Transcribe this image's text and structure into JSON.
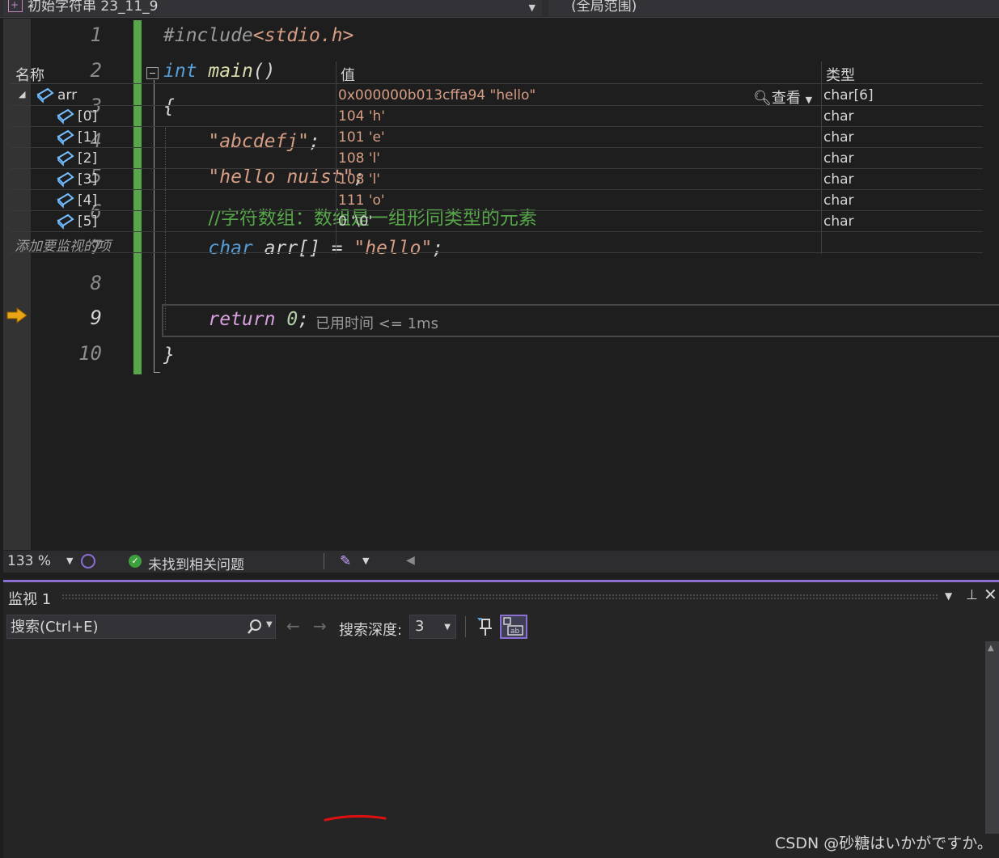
{
  "navbar": {
    "file_scope": "初始字符串 23_11_9",
    "member_scope": "(全局范围)"
  },
  "editor": {
    "line_numbers": [
      "1",
      "2",
      "3",
      "4",
      "5",
      "6",
      "7",
      "8",
      "9",
      "10"
    ],
    "current_line": "9",
    "lines": {
      "l1_directive": "#include",
      "l1_header": "<stdio.h>",
      "l2_type": "int",
      "l2_name": "main",
      "l2_parens": "()",
      "l3_brace": "{",
      "l4_string": "\"abcdefj\"",
      "l4_semi": ";",
      "l5_string": "\"hello nuist\"",
      "l5_semi": ";",
      "l6_comment": "//字符数组：数组是一组形同类型的元素",
      "l7_type": "char",
      "l7_decl": " arr[] = ",
      "l7_string": "\"hello\"",
      "l7_semi": ";",
      "l9_keyword": "return",
      "l9_number": " 0",
      "l9_semi": ";",
      "l10_brace": "}"
    },
    "elapsed_hint": "已用时间 <= 1ms"
  },
  "status": {
    "zoom": "133 %",
    "issues": "未找到相关问题"
  },
  "watch": {
    "title": "监视 1",
    "search_placeholder": "搜索(Ctrl+E)",
    "depth_label": "搜索深度:",
    "depth_value": "3",
    "columns": {
      "name": "名称",
      "value": "值",
      "type": "类型"
    },
    "root": {
      "name": "arr",
      "value": "0x000000b013cffa94 \"hello\"",
      "type": "char[6]",
      "view_label": "查看"
    },
    "children": [
      {
        "name": "[0]",
        "value": "104 'h'",
        "type": "char"
      },
      {
        "name": "[1]",
        "value": "101 'e'",
        "type": "char"
      },
      {
        "name": "[2]",
        "value": "108 'l'",
        "type": "char"
      },
      {
        "name": "[3]",
        "value": "108 'l'",
        "type": "char"
      },
      {
        "name": "[4]",
        "value": "111 'o'",
        "type": "char"
      },
      {
        "name": "[5]",
        "value": "0 '\\0'",
        "type": "char"
      }
    ],
    "add_item": "添加要监视的项"
  },
  "watermark": "CSDN @砂糖はいかがですか。",
  "colors": {
    "accent": "#8a6fd1",
    "keyword": "#569cd6",
    "string": "#d69d85",
    "comment": "#57a64a",
    "change_bar": "#57a64a",
    "exec_arrow": "#e8a317"
  }
}
